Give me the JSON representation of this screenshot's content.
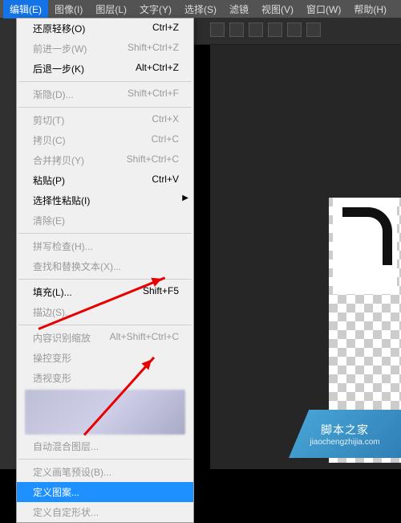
{
  "menubar": {
    "items": [
      {
        "label": "编辑(E)",
        "active": true
      },
      {
        "label": "图像(I)"
      },
      {
        "label": "图层(L)"
      },
      {
        "label": "文字(Y)"
      },
      {
        "label": "选择(S)"
      },
      {
        "label": "滤镜"
      },
      {
        "label": "视图(V)"
      },
      {
        "label": "窗口(W)"
      },
      {
        "label": "帮助(H)"
      }
    ]
  },
  "dropdown": [
    {
      "type": "item",
      "label": "还原轻移(O)",
      "shortcut": "Ctrl+Z"
    },
    {
      "type": "item",
      "label": "前进一步(W)",
      "shortcut": "Shift+Ctrl+Z",
      "disabled": true
    },
    {
      "type": "item",
      "label": "后退一步(K)",
      "shortcut": "Alt+Ctrl+Z"
    },
    {
      "type": "sep"
    },
    {
      "type": "item",
      "label": "渐隐(D)...",
      "shortcut": "Shift+Ctrl+F",
      "disabled": true
    },
    {
      "type": "sep"
    },
    {
      "type": "item",
      "label": "剪切(T)",
      "shortcut": "Ctrl+X",
      "disabled": true
    },
    {
      "type": "item",
      "label": "拷贝(C)",
      "shortcut": "Ctrl+C",
      "disabled": true
    },
    {
      "type": "item",
      "label": "合并拷贝(Y)",
      "shortcut": "Shift+Ctrl+C",
      "disabled": true
    },
    {
      "type": "item",
      "label": "粘贴(P)",
      "shortcut": "Ctrl+V"
    },
    {
      "type": "item",
      "label": "选择性粘贴(I)",
      "sub": true
    },
    {
      "type": "item",
      "label": "清除(E)",
      "disabled": true
    },
    {
      "type": "sep"
    },
    {
      "type": "item",
      "label": "拼写检查(H)...",
      "disabled": true
    },
    {
      "type": "item",
      "label": "查找和替换文本(X)...",
      "disabled": true
    },
    {
      "type": "sep"
    },
    {
      "type": "item",
      "label": "填充(L)...",
      "shortcut": "Shift+F5"
    },
    {
      "type": "item",
      "label": "描边(S)...",
      "disabled": true
    },
    {
      "type": "sep"
    },
    {
      "type": "item",
      "label": "内容识别缩放",
      "shortcut": "Alt+Shift+Ctrl+C",
      "disabled": true
    },
    {
      "type": "item",
      "label": "操控变形",
      "disabled": true
    },
    {
      "type": "item",
      "label": "透视变形",
      "disabled": true
    },
    {
      "type": "blur"
    },
    {
      "type": "item",
      "label": "自动混合图层...",
      "disabled": true
    },
    {
      "type": "sep"
    },
    {
      "type": "item",
      "label": "定义画笔预设(B)...",
      "disabled": true
    },
    {
      "type": "item",
      "label": "定义图案...",
      "highlight": true
    },
    {
      "type": "item",
      "label": "定义自定形状...",
      "disabled": true
    }
  ],
  "badge": {
    "line1": "脚本之家",
    "line2": "jiaochengzhijia.com"
  },
  "colors": {
    "accent": "#1473e6",
    "highlight": "#1e90ff",
    "arrow": "#e60000"
  }
}
